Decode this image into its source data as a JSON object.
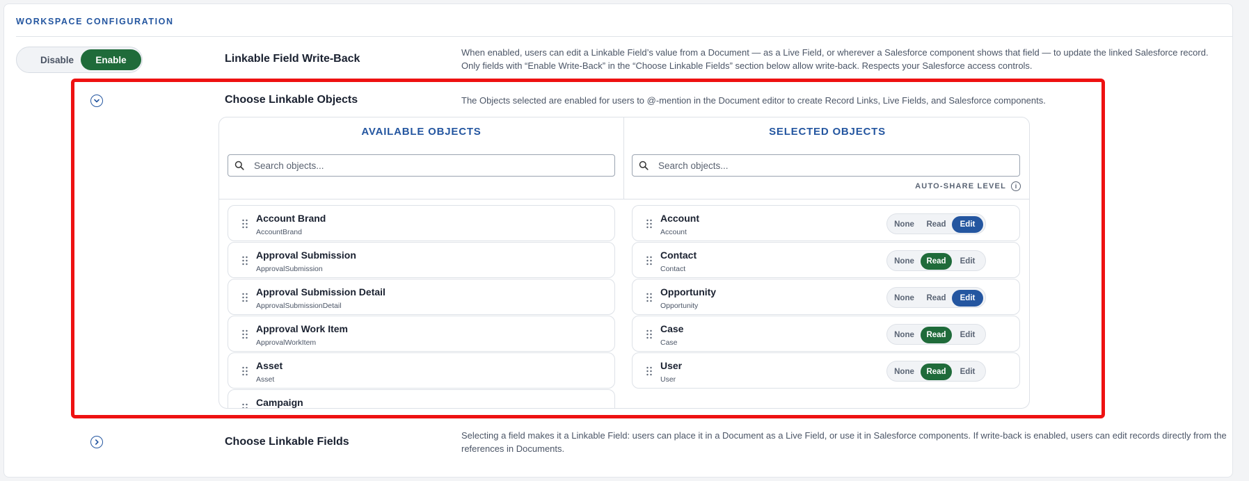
{
  "section": {
    "title": "WORKSPACE CONFIGURATION"
  },
  "writeback": {
    "toggle": {
      "disable": "Disable",
      "enable": "Enable",
      "selected": "Enable"
    },
    "label": "Linkable Field Write-Back",
    "description": "When enabled, users can edit a Linkable Field’s value from a Document — as a Live Field, or wherever a Salesforce component shows that field — to update the linked Salesforce record. Only fields with “Enable Write-Back” in the “Choose Linkable Fields” section below allow write-back. Respects your Salesforce access controls."
  },
  "objects": {
    "label": "Choose Linkable Objects",
    "description": "The Objects selected are enabled for users to @-mention in the Document editor to create Record Links, Live Fields, and Salesforce components.",
    "expanded": true,
    "available": {
      "heading": "AVAILABLE OBJECTS",
      "search_placeholder": "Search objects...",
      "items": [
        {
          "name": "Account Brand",
          "api": "AccountBrand"
        },
        {
          "name": "Approval Submission",
          "api": "ApprovalSubmission"
        },
        {
          "name": "Approval Submission Detail",
          "api": "ApprovalSubmissionDetail"
        },
        {
          "name": "Approval Work Item",
          "api": "ApprovalWorkItem"
        },
        {
          "name": "Asset",
          "api": "Asset"
        },
        {
          "name": "Campaign",
          "api": ""
        }
      ]
    },
    "selected": {
      "heading": "SELECTED OBJECTS",
      "search_placeholder": "Search objects...",
      "auto_share_label": "AUTO-SHARE LEVEL",
      "levels": [
        "None",
        "Read",
        "Edit"
      ],
      "items": [
        {
          "name": "Account",
          "api": "Account",
          "level": "Edit"
        },
        {
          "name": "Contact",
          "api": "Contact",
          "level": "Read"
        },
        {
          "name": "Opportunity",
          "api": "Opportunity",
          "level": "Edit"
        },
        {
          "name": "Case",
          "api": "Case",
          "level": "Read"
        },
        {
          "name": "User",
          "api": "User",
          "level": "Read"
        }
      ]
    }
  },
  "fields": {
    "label": "Choose Linkable Fields",
    "description": "Selecting a field makes it a Linkable Field: users can place it in a Document as a Live Field, or use it in Salesforce components. If write-back is enabled, users can edit records directly from the references in Documents.",
    "expanded": false
  },
  "colors": {
    "accent": "#2456a0",
    "enable_green": "#1f6b3a",
    "highlight": "#ee1111"
  }
}
